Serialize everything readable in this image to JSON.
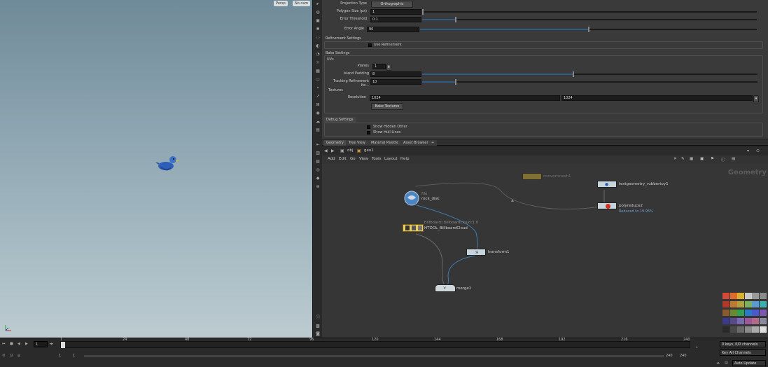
{
  "viewport": {
    "persp_label": "Persp",
    "cam_label": "No cam"
  },
  "params": {
    "projection_type_label": "Projection Type",
    "projection_type_value": "Orthographic",
    "polygon_size_label": "Polygon Size (px)",
    "polygon_size_value": "1",
    "polygon_size_fraction": 0.0,
    "error_threshold_label": "Error Threshold",
    "error_threshold_value": "0.1",
    "error_threshold_fraction": 0.1,
    "error_angle_label": "Error Angle",
    "error_angle_value": "90",
    "error_angle_fraction": 0.5,
    "refinement_title": "Refinement Settings",
    "use_refinement_label": "Use Refinement",
    "bake_settings_title": "Bake Settings",
    "uvs_title": "UVs",
    "planes_label": "Planes",
    "planes_value": "1",
    "island_padding_label": "Island Padding",
    "island_padding_value": "8",
    "island_padding_fraction": 0.45,
    "tracking_label": "Tracking Refinement Ite...",
    "tracking_value": "10",
    "tracking_fraction": 0.1,
    "textures_title": "Textures",
    "resolution_label": "Resolution",
    "resolution_x": "1024",
    "resolution_y": "1024",
    "bake_button": "Bake Textures",
    "debug_tab": "Debug Settings",
    "show_hidden_label": "Show Hidden Other",
    "show_hull_label": "Show Hull Lines"
  },
  "net_tabs": [
    "Geometry",
    "Tree View",
    "Material Palette",
    "Asset Browser"
  ],
  "net_path": {
    "obj": "obj",
    "geo": "geo1"
  },
  "net_menu": [
    "Add",
    "Edit",
    "Go",
    "View",
    "Tools",
    "Layout",
    "Help"
  ],
  "network_context": "Geometry",
  "nodes": {
    "file_type": "file",
    "file_name": "rock_disk",
    "billboard_type": "billboard::billboardcloud:1.0",
    "billboard_name": "HTOOL_BillboardCloud",
    "transform_name": "transform1",
    "merge_name": "merge1",
    "convert_name": "convertmesh1",
    "testgeo_name": "testgeometry_rubbertoy1",
    "polyreduce_name": "polyreduce2",
    "polyreduce_note": "Reduced to 19.95%"
  },
  "timeline": {
    "frame": "1",
    "start": "1",
    "start2": "1",
    "end": "240",
    "end2": "240",
    "ticks": [
      "1",
      "24",
      "48",
      "72",
      "96",
      "120",
      "144",
      "168",
      "192",
      "216",
      "240"
    ],
    "keys_label": "0 keys, 0/0 channels",
    "key_all_label": "Key All Channels",
    "auto_update": "Auto Update"
  },
  "palette_colors": [
    "#d24a3a",
    "#e06a2a",
    "#d8b030",
    "#c8c8c8",
    "#9a9a9a",
    "#8a8a8a",
    "#b03a2a",
    "#c07a30",
    "#b0a040",
    "#78b060",
    "#5a9ad0",
    "#3ab0b0",
    "#8a5a30",
    "#6a8a30",
    "#30a050",
    "#2a7ac8",
    "#4a5ac8",
    "#7a5ab0",
    "#3a3a8a",
    "#5a4a8a",
    "#7a6ab0",
    "#9a5a9a",
    "#b06a8a",
    "#8a8a9a",
    "#2a2a2a",
    "#4a4a4a",
    "#6a6a6a",
    "#8a8a8a",
    "#aaaaaa",
    "#dddddd"
  ]
}
